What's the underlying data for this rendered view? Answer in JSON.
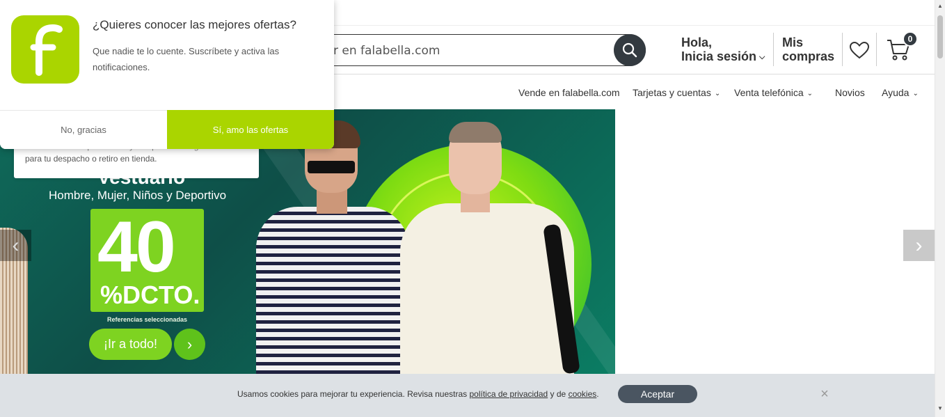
{
  "header": {
    "search_placeholder": "Buscar en falabella.com",
    "search_visible": "r en falabella.com",
    "login_line1": "Hola,",
    "login_line2": "Inicia sesión",
    "purchases_line1": "Mis",
    "purchases_line2": "compras",
    "cart_count": "0"
  },
  "nav": {
    "items": [
      {
        "label": "Vende en falabella.com"
      },
      {
        "label": "Tarjetas y cuentas"
      },
      {
        "label": "Venta telefónica"
      },
      {
        "label": "Novios"
      },
      {
        "label": "Ayuda"
      }
    ]
  },
  "info_card": {
    "line1": "Podrás ver la disponibilidad y tiempo de entrega",
    "line2": "para tu despacho o retiro en tienda."
  },
  "banner": {
    "title": "Vestuario",
    "subtitle": "Hombre, Mujer, Niños y Deportivo",
    "discount_number": "40",
    "discount_label": "%DCTO.",
    "note": "Referencias seleccionadas",
    "cta": "¡Ir a todo!"
  },
  "popup": {
    "title": "¿Quieres conocer las mejores ofertas?",
    "body": "Que nadie te lo cuente. Suscríbete y activa las notificaciones.",
    "decline": "No, gracias",
    "accept": "Sí, amo las ofertas"
  },
  "cookies": {
    "text_before": "Usamos cookies para mejorar tu experiencia. Revisa nuestras ",
    "privacy_link": "política de privacidad",
    "text_middle": " y de ",
    "cookies_link": "cookies",
    "text_after": ".",
    "accept": "Aceptar"
  },
  "colors": {
    "brand_green": "#aad500",
    "dark": "#333a40",
    "cookie_bg": "#dde1e5"
  }
}
